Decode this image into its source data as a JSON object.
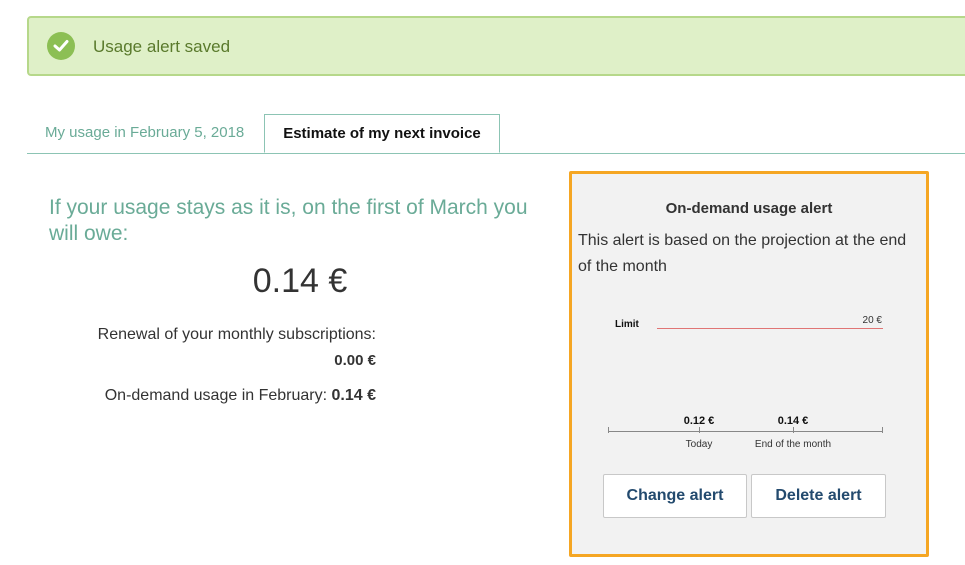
{
  "banner": {
    "message": "Usage alert saved",
    "icon": "check-icon",
    "color": "#8cbf54"
  },
  "tabs": [
    {
      "label": "My usage in February 5, 2018",
      "active": false
    },
    {
      "label": "Estimate of my next invoice",
      "active": true
    }
  ],
  "estimate": {
    "headline": "If your usage stays as it is, on the first of March you will owe:",
    "total": "0.14 €",
    "renewal_label": "Renewal of your monthly subscriptions:",
    "renewal_value": "0.00 €",
    "ondemand_label": "On-demand usage in February:",
    "ondemand_value": "0.14 €"
  },
  "alert_panel": {
    "title": "On-demand usage alert",
    "description": "This alert is based on the projection at the end of the month",
    "limit_label": "Limit",
    "limit_value": "20 €",
    "today_value": "0.12 €",
    "today_caption": "Today",
    "eom_value": "0.14 €",
    "eom_caption": "End of the month",
    "change_button": "Change alert",
    "delete_button": "Delete alert",
    "border_color": "#f5a623"
  }
}
